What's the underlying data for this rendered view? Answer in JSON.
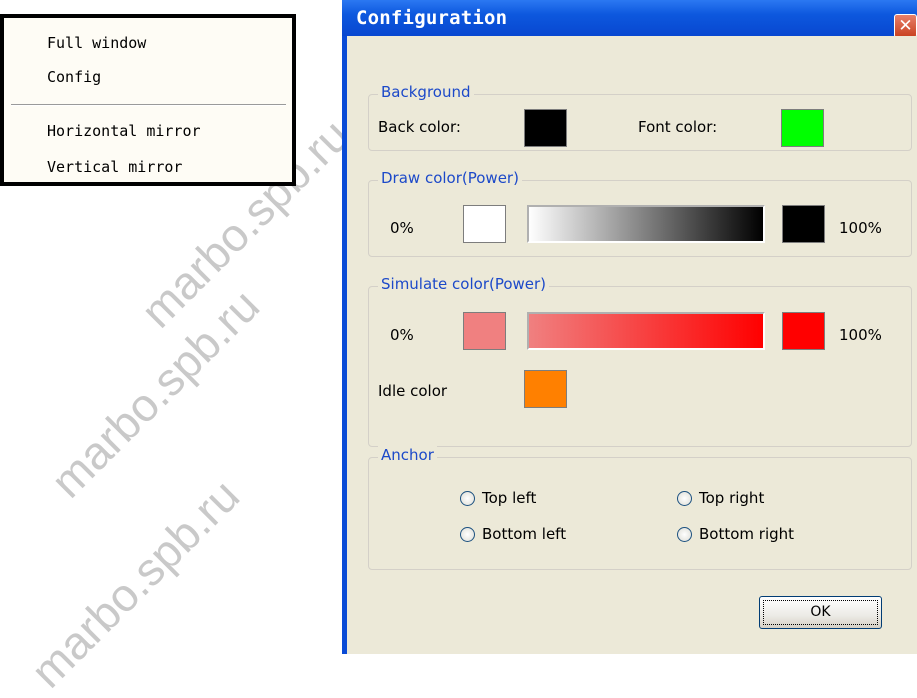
{
  "watermark": "marbo.spb.ru",
  "context_menu": {
    "items": [
      "Full window",
      "Config",
      "Horizontal mirror",
      "Vertical mirror"
    ]
  },
  "dialog": {
    "title": "Configuration",
    "close_glyph": "✕",
    "background_group": {
      "title": "Background",
      "back_color_label": "Back color:",
      "back_color": "#000000",
      "font_color_label": "Font color:",
      "font_color": "#00ff00"
    },
    "draw_group": {
      "title": "Draw color(Power)",
      "min_label": "0%",
      "max_label": "100%",
      "min_color": "#ffffff",
      "max_color": "#000000"
    },
    "simulate_group": {
      "title": "Simulate color(Power)",
      "min_label": "0%",
      "max_label": "100%",
      "min_color": "#f08080",
      "max_color": "#ff0000",
      "idle_label": "Idle color",
      "idle_color": "#ff8000"
    },
    "anchor_group": {
      "title": "Anchor",
      "options": [
        "Top left",
        "Top right",
        "Bottom left",
        "Bottom right"
      ]
    },
    "ok_label": "OK"
  },
  "colors": {
    "titlebar": "#0a4bd6",
    "dialog_face": "#ece9d8",
    "group_title": "#1c49c9",
    "close_button": "#c8401f"
  }
}
